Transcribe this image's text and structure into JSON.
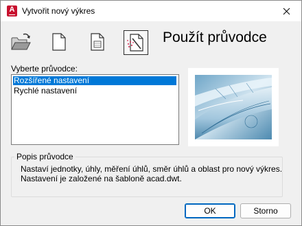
{
  "window": {
    "title": "Vytvořit nový výkres"
  },
  "toolbar": {
    "icons": [
      "open-folder-icon",
      "blank-page-icon",
      "template-page-icon",
      "wizard-icon"
    ]
  },
  "heading": "Použít průvodce",
  "wizard_list": {
    "label": "Vyberte průvodce:",
    "items": [
      "Rozšířené nastavení",
      "Rychlé nastavení"
    ],
    "selected_index": 0
  },
  "description": {
    "legend": "Popis průvodce",
    "line1": "Nastaví jednotky, úhly, měření úhlů, směr úhlů a oblast pro nový výkres.",
    "line2": "Nastavení je založené na šabloně acad.dwt."
  },
  "buttons": {
    "ok": "OK",
    "cancel": "Storno"
  },
  "colors": {
    "selection": "#0078d7",
    "accent": "#0067c0",
    "app_icon": "#c8102e"
  }
}
